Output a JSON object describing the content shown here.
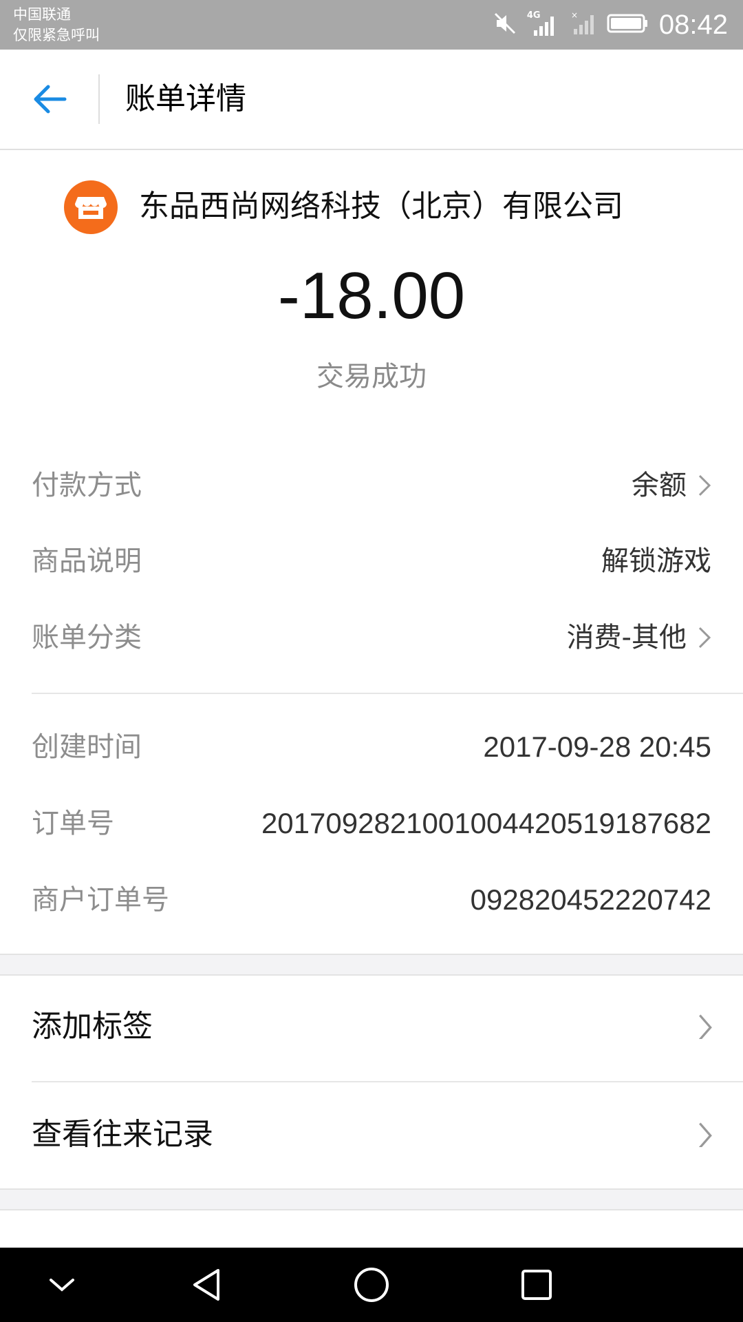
{
  "status_bar": {
    "carrier": "中国联通",
    "carrier_note": "仅限紧急呼叫",
    "network_label": "4G",
    "time": "08:42",
    "icons": [
      "mute-icon",
      "signal-4g-icon",
      "signal-no-sim-icon",
      "battery-icon"
    ]
  },
  "app_bar": {
    "title": "账单详情",
    "back_icon": "arrow-left-icon",
    "accent_color": "#1a8be3"
  },
  "transaction": {
    "merchant": "东品西尚网络科技（北京）有限公司",
    "merchant_icon": "storefront-icon",
    "merchant_icon_color": "#f46c1b",
    "amount": "-18.00",
    "status": "交易成功"
  },
  "details": {
    "payment_method": {
      "label": "付款方式",
      "value": "余额"
    },
    "description": {
      "label": "商品说明",
      "value": "解锁游戏"
    },
    "category": {
      "label": "账单分类",
      "value": "消费-其他"
    },
    "created_time": {
      "label": "创建时间",
      "value": "2017-09-28 20:45"
    },
    "order_no": {
      "label": "订单号",
      "value": "20170928210010044205191876​82"
    },
    "merchant_order_no": {
      "label": "商户订单号",
      "value": "092820452220742"
    }
  },
  "actions": {
    "add_tag": "添加标签",
    "view_history": "查看往来记录"
  },
  "nav_bar": {
    "icons": [
      "collapse-icon",
      "back-triangle-icon",
      "home-circle-icon",
      "recents-square-icon"
    ]
  }
}
